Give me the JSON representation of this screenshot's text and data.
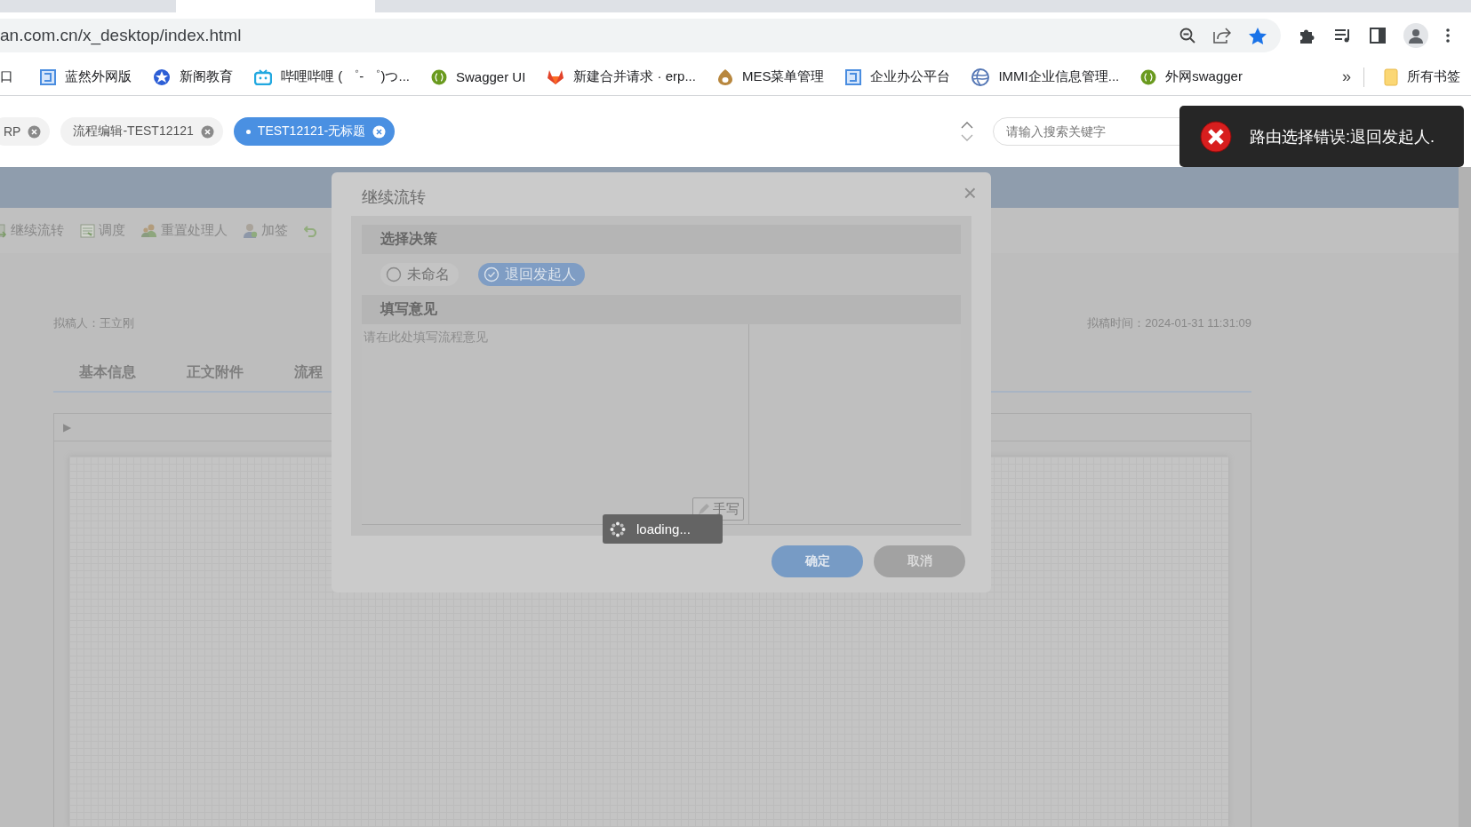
{
  "browser": {
    "address": "an.com.cn/x_desktop/index.html",
    "bookmarks": [
      {
        "label": "口",
        "kind": "none"
      },
      {
        "label": "蓝然外网版",
        "kind": "square"
      },
      {
        "label": "新阁教育",
        "kind": "star"
      },
      {
        "label": "哔哩哔哩 ( ゜- ゜)つ...",
        "kind": "tv"
      },
      {
        "label": "Swagger UI",
        "kind": "swagger"
      },
      {
        "label": "新建合并请求 · erp...",
        "kind": "fox"
      },
      {
        "label": "MES菜单管理",
        "kind": "ring"
      },
      {
        "label": "企业办公平台",
        "kind": "square"
      },
      {
        "label": "IMMI企业信息管理...",
        "kind": "globe"
      },
      {
        "label": "外网swagger",
        "kind": "swagger"
      }
    ],
    "overflow": "»",
    "folder": "所有书签"
  },
  "app": {
    "tabs": [
      {
        "label": "RP",
        "selected": false
      },
      {
        "label": "流程编辑-TEST12121",
        "selected": false
      },
      {
        "label": "TEST12121-无标题",
        "selected": true
      }
    ],
    "search": {
      "placeholder": "请输入搜索关键字"
    }
  },
  "toolbar": [
    {
      "label": "继续流转",
      "kind": "forward"
    },
    {
      "label": "调度",
      "kind": "sheet"
    },
    {
      "label": "重置处理人",
      "kind": "people"
    },
    {
      "label": "加签",
      "kind": "person"
    },
    {
      "kind": "return"
    }
  ],
  "document": {
    "drafter": "拟稿人：王立刚",
    "draft_time": "拟稿时间：2024-01-31 11:31:09",
    "tabs": [
      "基本信息",
      "正文附件",
      "流程"
    ],
    "panel_toggle": "▶"
  },
  "dialog": {
    "title": "继续流转",
    "close": "×",
    "decision_heading": "选择决策",
    "options": [
      {
        "label": "未命名",
        "selected": false
      },
      {
        "label": "退回发起人",
        "selected": true
      }
    ],
    "opinion_heading": "填写意见",
    "opinion": {
      "placeholder": "请在此处填写流程意见"
    },
    "handwrite": "手写",
    "buttons": [
      {
        "label": "确定",
        "kind": "primary"
      },
      {
        "label": "取消",
        "kind": "secondary"
      }
    ]
  },
  "loading": "loading...",
  "toast": {
    "message": "路由选择错误:退回发起人.",
    "kind": "error"
  }
}
